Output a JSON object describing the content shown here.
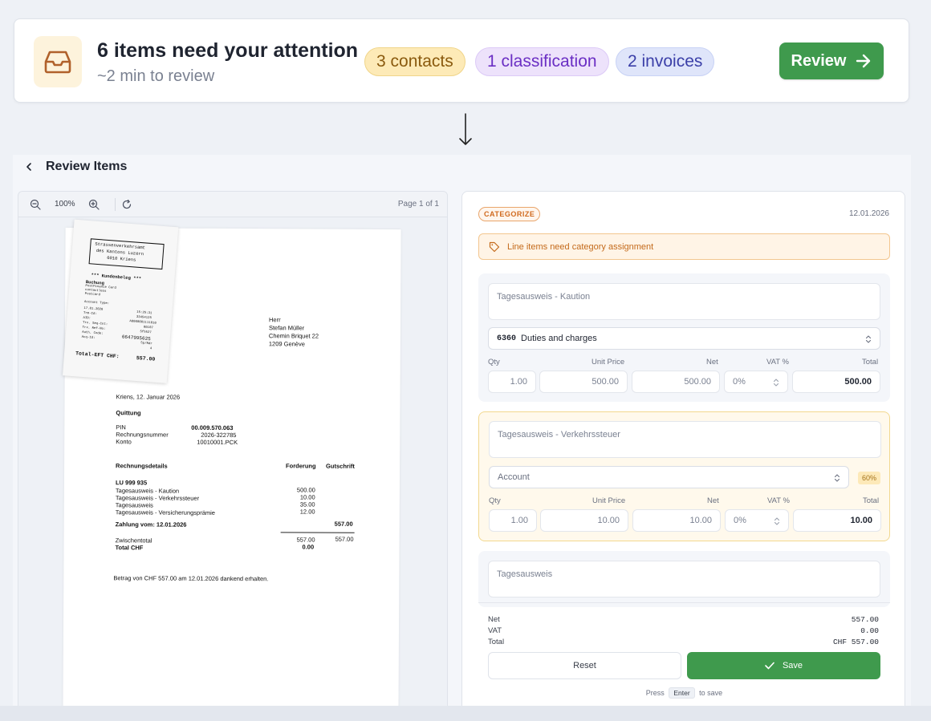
{
  "banner": {
    "title": "6 items need your attention",
    "subtitle": "~2 min to review",
    "pills": {
      "contacts": "3 contacts",
      "classification": "1 classification",
      "invoices": "2 invoices"
    },
    "review_label": "Review",
    "colors": {
      "accent": "#3f9a4d",
      "contacts": "#fdeab7",
      "classification": "#ede2fb",
      "invoices": "#dfe5fa"
    },
    "icon": "inbox-icon"
  },
  "panel": {
    "title": "Review Items"
  },
  "viewer": {
    "zoom": "100%",
    "page_indicator": "Page 1 of 1"
  },
  "document": {
    "receipt": {
      "lines": [
        "Strassenverkehrsamt",
        "des Kantons Luzern",
        "6010 Kriens",
        "*** Kundenbeleg ***",
        "Buchung",
        "PostFinance Card",
        "contactless",
        "Postcard",
        "Account Type:",
        "17.01.2026",
        "Trm-Id:",
        "AID:",
        "Trx. Seq-Cnt:",
        "Trx. Ref-No:",
        "Auth. Code:",
        "Acq-Id:",
        "Total-EFT CHF:"
      ],
      "values": [
        "15:25:31",
        "33454125",
        "A0000001111010",
        "00107",
        "5f5527",
        "6647995625",
        "5p/Rdr",
        "4",
        "557.00"
      ]
    },
    "recipient": [
      "Herr",
      "Stefan Müller",
      "Chemin Briquet 22",
      "1209 Genève"
    ],
    "place_date": "Kriens, 12. Januar 2026",
    "heading": "Quittung",
    "meta": [
      {
        "label": "PIN",
        "value": "00.009.570.063"
      },
      {
        "label": "Rechnungsnummer",
        "value": "2026-322785"
      },
      {
        "label": "Konto",
        "value": "10010001.PCK"
      }
    ],
    "details_head": {
      "label": "Rechnungsdetails",
      "col1": "Forderung",
      "col2": "Gutschrift"
    },
    "lu_code": "LU 999 935",
    "lines": [
      {
        "label": "Tagesausweis - Kaution",
        "value": "500.00"
      },
      {
        "label": "Tagesausweis - Verkehrssteuer",
        "value": "10.00"
      },
      {
        "label": "Tagesausweis",
        "value": "35.00"
      },
      {
        "label": "Tagesausweis - Versicherungsprämie",
        "value": "12.00"
      }
    ],
    "payment": {
      "label": "Zahlung vom: 12.01.2026",
      "value": "557.00"
    },
    "subtotal": {
      "label": "Zwischentotal",
      "value1": "557.00",
      "value2": "557.00"
    },
    "total": {
      "label": "Total CHF",
      "value": "0.00"
    },
    "footer": "Betrag von CHF 557.00 am 12.01.2026 dankend erhalten."
  },
  "form": {
    "badge": "CATEGORIZE",
    "date": "12.01.2026",
    "alert": "Line items need category assignment",
    "column_labels": {
      "qty": "Qty",
      "unit_price": "Unit Price",
      "net": "Net",
      "vat": "VAT %",
      "total": "Total"
    },
    "items": [
      {
        "description": "Tagesausweis - Kaution",
        "account_code": "6360",
        "account_name": "Duties and charges",
        "qty": "1.00",
        "unit_price": "500.00",
        "net": "500.00",
        "vat": "0%",
        "total": "500.00"
      },
      {
        "description": "Tagesausweis - Verkehrssteuer",
        "account_placeholder": "Account",
        "confidence": "60%",
        "qty": "1.00",
        "unit_price": "10.00",
        "net": "10.00",
        "vat": "0%",
        "total": "10.00"
      },
      {
        "description": "Tagesausweis"
      }
    ],
    "totals": {
      "net_label": "Net",
      "net": "557.00",
      "vat_label": "VAT",
      "vat": "0.00",
      "total_label": "Total",
      "total": "CHF 557.00"
    },
    "reset_label": "Reset",
    "save_label": "Save",
    "hint_pre": "Press",
    "hint_key": "Enter",
    "hint_post": "to save"
  }
}
